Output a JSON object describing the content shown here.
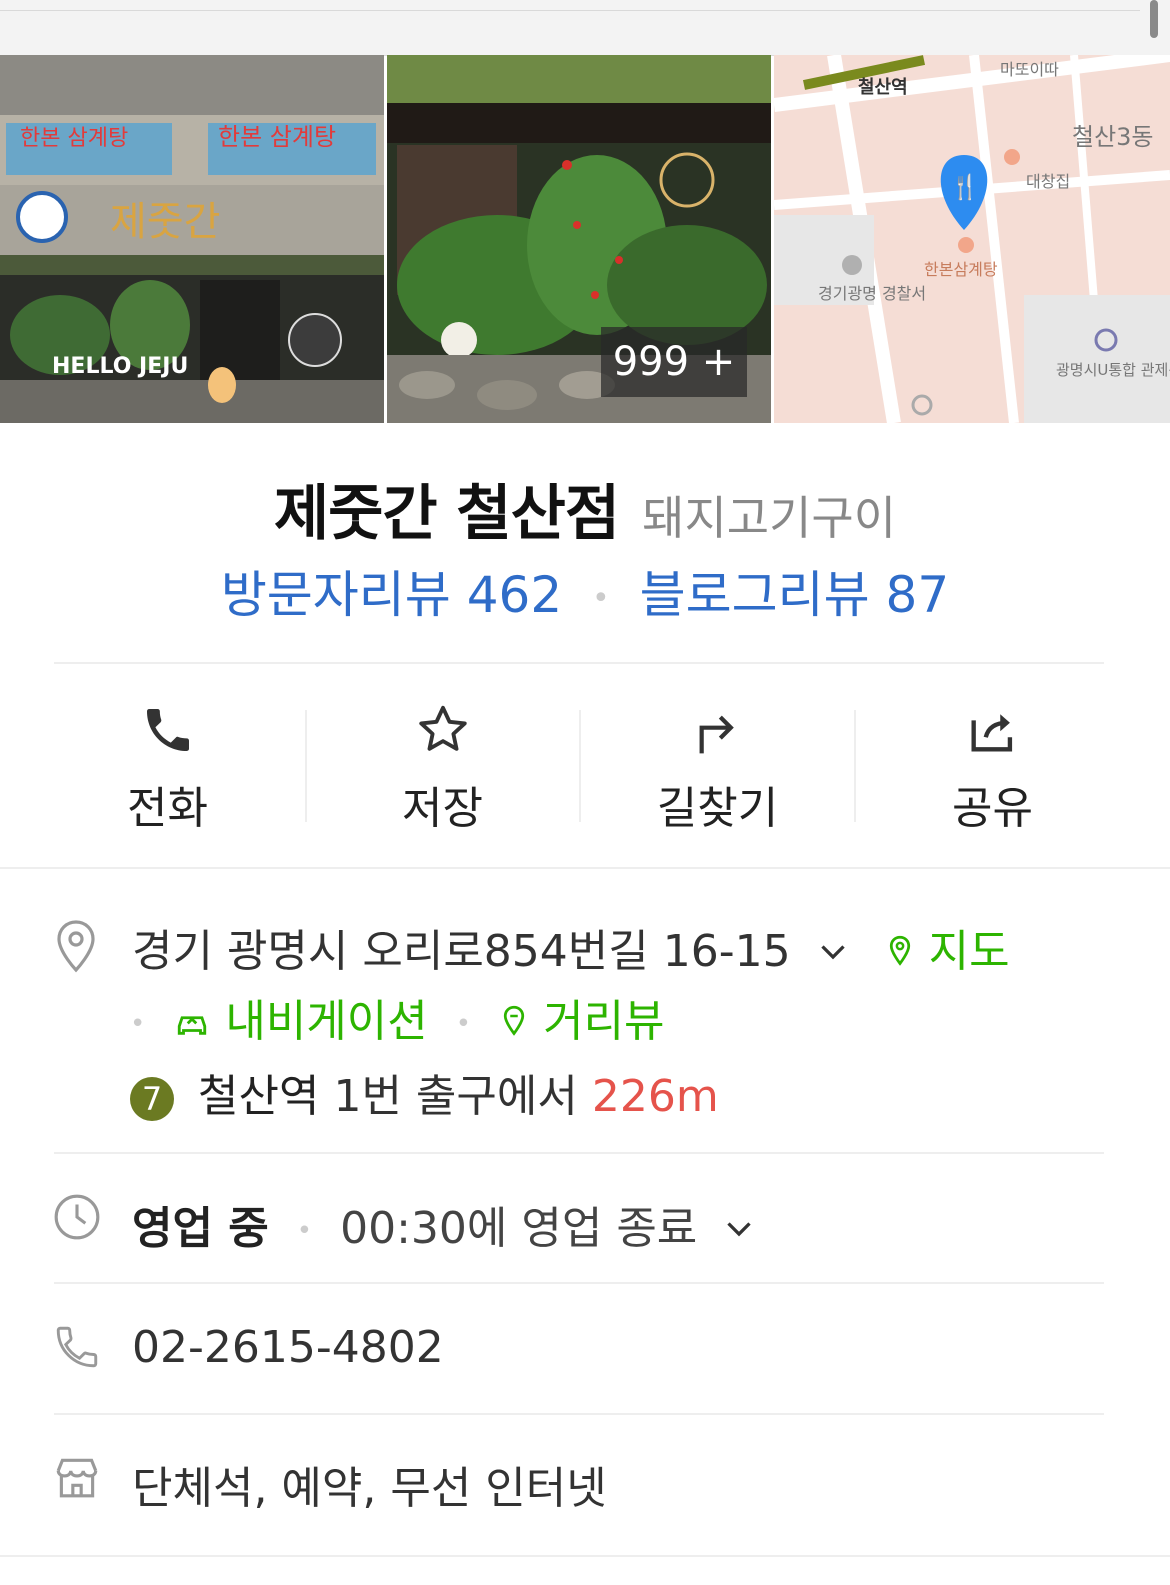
{
  "photos": {
    "count_badge": "999 +",
    "storefront_signs": [
      "한본 삼계탕",
      "제줏간",
      "HELLO JEJU"
    ],
    "map_labels": [
      "철산역",
      "마또이따",
      "철산3동",
      "대창집",
      "한본삼계탕",
      "경기광명 경찰서",
      "광명시U통합 관제센터"
    ],
    "map_pin_color": "#2d8cf0"
  },
  "place": {
    "name": "제줏간 철산점",
    "category": "돼지고기구이",
    "visitor_reviews": "방문자리뷰 462",
    "blog_reviews": "블로그리뷰 87"
  },
  "actions": [
    {
      "label": "전화",
      "icon": "phone-icon"
    },
    {
      "label": "저장",
      "icon": "star-icon"
    },
    {
      "label": "길찾기",
      "icon": "directions-icon"
    },
    {
      "label": "공유",
      "icon": "share-icon"
    }
  ],
  "address": {
    "text": "경기 광명시 오리로854번길 16-15",
    "map_link": "지도",
    "navigation_link": "내비게이션",
    "street_view_link": "거리뷰"
  },
  "subway": {
    "line_number": "7",
    "line_color": "#6b7a22",
    "station": "철산역",
    "exit_text": "1번 출구에서",
    "distance": "226m"
  },
  "hours": {
    "status": "영업 중",
    "detail": "00:30에 영업 종료"
  },
  "phone": "02-2615-4802",
  "facilities": "단체석, 예약, 무선 인터넷",
  "colors": {
    "link_blue": "#2f6cc8",
    "link_green": "#2db400",
    "distance_red": "#e5534b"
  }
}
